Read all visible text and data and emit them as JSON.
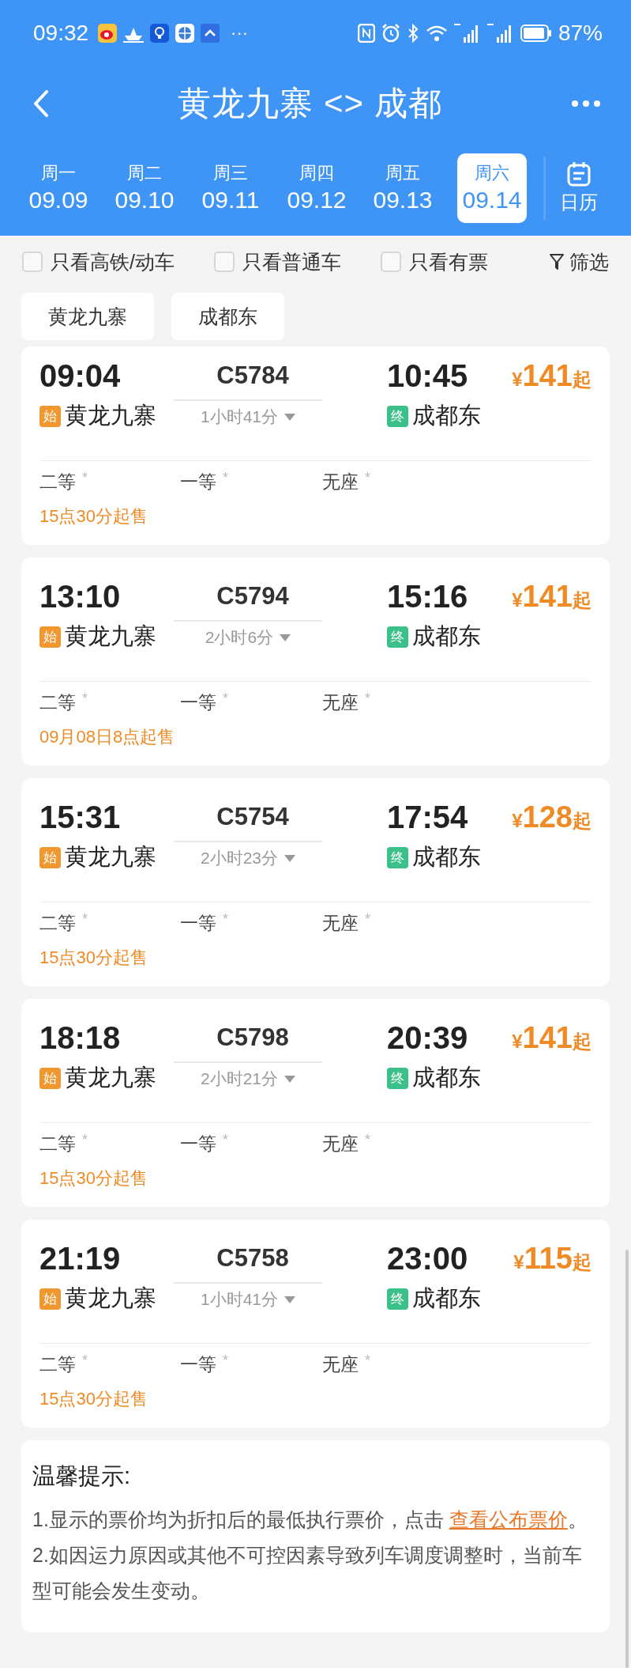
{
  "status_bar": {
    "time": "09:32",
    "more": "···",
    "battery_text": "87%"
  },
  "header": {
    "title": "黄龙九寨 <> 成都"
  },
  "dates": [
    {
      "weekday": "周一",
      "date": "09.09",
      "selected": false
    },
    {
      "weekday": "周二",
      "date": "09.10",
      "selected": false
    },
    {
      "weekday": "周三",
      "date": "09.11",
      "selected": false
    },
    {
      "weekday": "周四",
      "date": "09.12",
      "selected": false
    },
    {
      "weekday": "周五",
      "date": "09.13",
      "selected": false
    },
    {
      "weekday": "周六",
      "date": "09.14",
      "selected": true
    }
  ],
  "calendar_label": "日历",
  "filters": [
    {
      "label": "只看高铁/动车",
      "checked": false
    },
    {
      "label": "只看普通车",
      "checked": false
    },
    {
      "label": "只看有票",
      "checked": false
    }
  ],
  "filter_button": "筛选",
  "stations": [
    "黄龙九寨",
    "成都东"
  ],
  "trains": [
    {
      "depart": "09:04",
      "number": "C5784",
      "arrive": "10:45",
      "currency": "¥",
      "price": "141",
      "price_suffix": "起",
      "start_badge": "始",
      "from": "黄龙九寨",
      "duration": "1小时41分",
      "end_badge": "终",
      "to": "成都东",
      "seats": [
        {
          "name": "二等",
          "count": "*"
        },
        {
          "name": "一等",
          "count": "*"
        },
        {
          "name": "无座",
          "count": "*"
        }
      ],
      "sale": "15点30分起售"
    },
    {
      "depart": "13:10",
      "number": "C5794",
      "arrive": "15:16",
      "currency": "¥",
      "price": "141",
      "price_suffix": "起",
      "start_badge": "始",
      "from": "黄龙九寨",
      "duration": "2小时6分",
      "end_badge": "终",
      "to": "成都东",
      "seats": [
        {
          "name": "二等",
          "count": "*"
        },
        {
          "name": "一等",
          "count": "*"
        },
        {
          "name": "无座",
          "count": "*"
        }
      ],
      "sale": "09月08日8点起售"
    },
    {
      "depart": "15:31",
      "number": "C5754",
      "arrive": "17:54",
      "currency": "¥",
      "price": "128",
      "price_suffix": "起",
      "start_badge": "始",
      "from": "黄龙九寨",
      "duration": "2小时23分",
      "end_badge": "终",
      "to": "成都东",
      "seats": [
        {
          "name": "二等",
          "count": "*"
        },
        {
          "name": "一等",
          "count": "*"
        },
        {
          "name": "无座",
          "count": "*"
        }
      ],
      "sale": "15点30分起售"
    },
    {
      "depart": "18:18",
      "number": "C5798",
      "arrive": "20:39",
      "currency": "¥",
      "price": "141",
      "price_suffix": "起",
      "start_badge": "始",
      "from": "黄龙九寨",
      "duration": "2小时21分",
      "end_badge": "终",
      "to": "成都东",
      "seats": [
        {
          "name": "二等",
          "count": "*"
        },
        {
          "name": "一等",
          "count": "*"
        },
        {
          "name": "无座",
          "count": "*"
        }
      ],
      "sale": "15点30分起售"
    },
    {
      "depart": "21:19",
      "number": "C5758",
      "arrive": "23:00",
      "currency": "¥",
      "price": "115",
      "price_suffix": "起",
      "start_badge": "始",
      "from": "黄龙九寨",
      "duration": "1小时41分",
      "end_badge": "终",
      "to": "成都东",
      "seats": [
        {
          "name": "二等",
          "count": "*"
        },
        {
          "name": "一等",
          "count": "*"
        },
        {
          "name": "无座",
          "count": "*"
        }
      ],
      "sale": "15点30分起售"
    }
  ],
  "tips": {
    "title": "温馨提示:",
    "items": [
      {
        "text": "1.显示的票价均为折扣后的最低执行票价，点击 ",
        "link": "查看公布票价",
        "tail": "。"
      },
      {
        "text": "2.如因运力原因或其他不可控因素导致列车调度调整时，当前车型可能会发生变动。"
      }
    ]
  }
}
